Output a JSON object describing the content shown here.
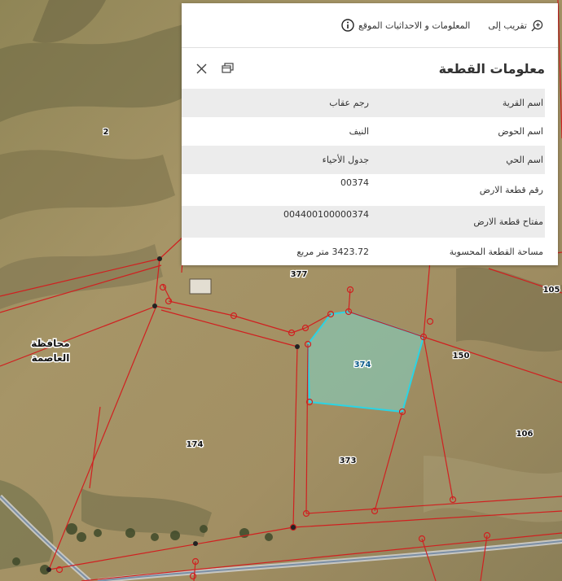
{
  "map": {
    "parcel_labels": [
      "2",
      "377",
      "105",
      "374",
      "150",
      "174",
      "373",
      "106"
    ],
    "governorate_label": [
      "محافظة",
      "العاصمة"
    ],
    "colors": {
      "boundary": "#d02020",
      "selected_outline": "#2bd4e4",
      "selected_fill": "#7fd6c8"
    }
  },
  "popup": {
    "actions": [
      {
        "label": "تقريب إلى",
        "icon": "zoom-in-icon"
      },
      {
        "label": "المعلومات و الاحداثيات الموقع",
        "icon": "info-icon"
      }
    ],
    "title": "معلومات القطعة",
    "rows": [
      {
        "key": "اسم القرية",
        "value": "رجم عقاب"
      },
      {
        "key": "اسم الحوض",
        "value": "النيف"
      },
      {
        "key": "اسم الحي",
        "value": "جدول الأحياء"
      },
      {
        "key": "رقم قطعة الارض",
        "value": "00374"
      },
      {
        "key": "مفتاح قطعة الارض",
        "value": "004400100000374"
      },
      {
        "key": "مساحة القطعة المحسوبة",
        "value": "3423.72 متر مربع"
      }
    ]
  }
}
